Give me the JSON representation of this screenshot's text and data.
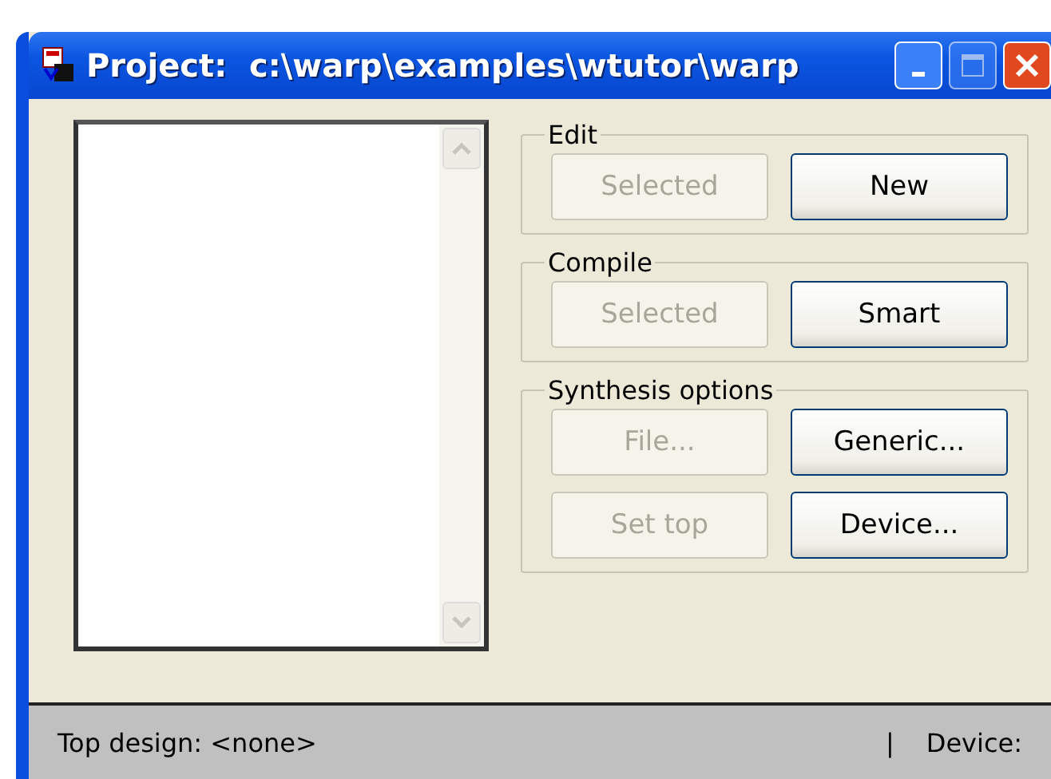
{
  "window": {
    "title": "Project:  c:\\warp\\examples\\wtutor\\warp"
  },
  "groups": [
    {
      "title": "Edit",
      "buttons": [
        {
          "label": "Selected",
          "disabled": true
        },
        {
          "label": "New",
          "disabled": false
        }
      ]
    },
    {
      "title": "Compile",
      "buttons": [
        {
          "label": "Selected",
          "disabled": true
        },
        {
          "label": "Smart",
          "disabled": false
        }
      ]
    },
    {
      "title": "Synthesis options",
      "buttons": [
        {
          "label": "File...",
          "disabled": true
        },
        {
          "label": "Generic...",
          "disabled": false
        },
        {
          "label": "Set top",
          "disabled": true
        },
        {
          "label": "Device...",
          "disabled": false
        }
      ]
    }
  ],
  "status_bar": {
    "top_design": "Top design: <none>",
    "separator": "|",
    "device": "Device:"
  }
}
